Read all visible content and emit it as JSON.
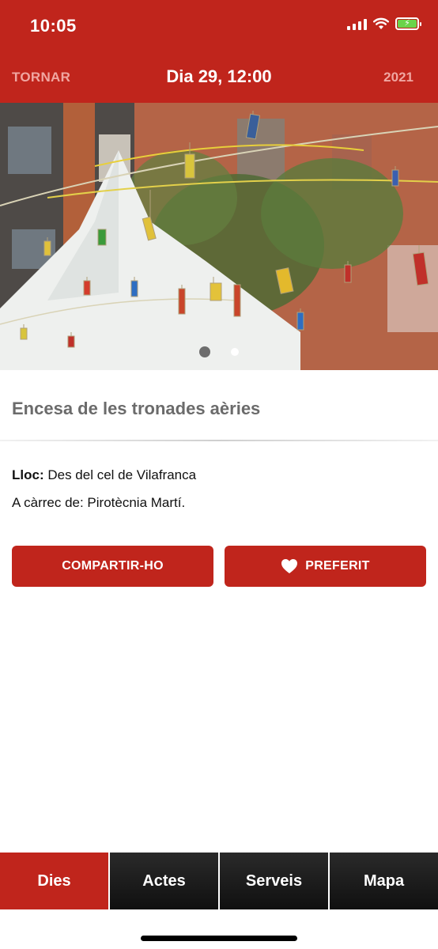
{
  "status_bar": {
    "time": "10:05",
    "battery_color": "#6ad34a"
  },
  "nav": {
    "back_label": "TORNAR",
    "title": "Dia 29, 12:00",
    "year": "2021"
  },
  "hero": {
    "carousel_pages": 2,
    "active_page": 1
  },
  "event": {
    "title": "Encesa de les tronades aèries",
    "place_label": "Lloc:",
    "place_value": "Des del cel de Vilafranca",
    "organizer": "A càrrec de: Pirotècnia Martí."
  },
  "actions": {
    "share_label": "COMPARTIR-HO",
    "favorite_label": "PREFERIT"
  },
  "tabs": [
    {
      "label": "Dies",
      "active": true
    },
    {
      "label": "Actes",
      "active": false
    },
    {
      "label": "Serveis",
      "active": false
    },
    {
      "label": "Mapa",
      "active": false
    }
  ],
  "colors": {
    "brand": "#c0251c",
    "tab_bg": "#1c1c1c",
    "title_gray": "#6b6b6b"
  }
}
